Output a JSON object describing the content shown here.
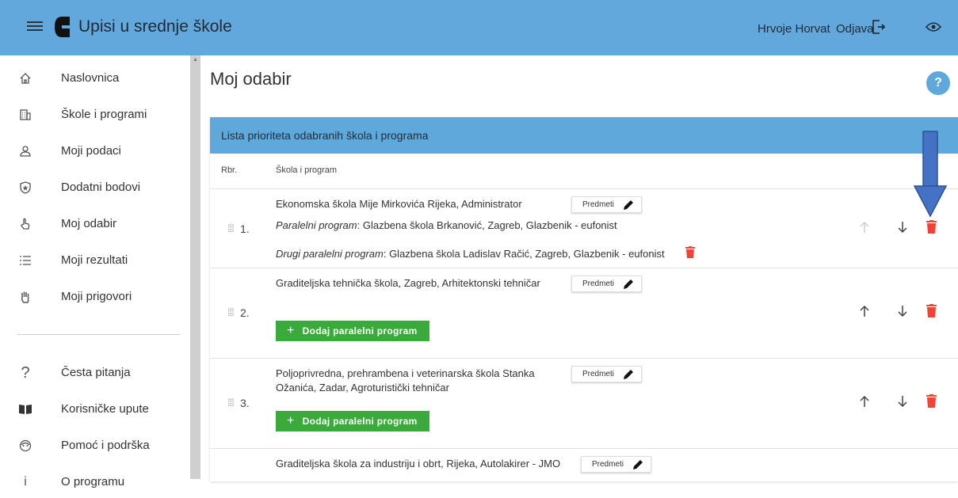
{
  "header": {
    "app_title": "Upisi u srednje škole",
    "user_name": "Hrvoje Horvat",
    "logout_label": "Odjava"
  },
  "sidebar": {
    "items": [
      {
        "label": "Naslovnica",
        "icon": "home-icon"
      },
      {
        "label": "Škole i programi",
        "icon": "building-icon"
      },
      {
        "label": "Moji podaci",
        "icon": "user-icon"
      },
      {
        "label": "Dodatni bodovi",
        "icon": "shield-star-icon"
      },
      {
        "label": "Moj odabir",
        "icon": "hand-pointer-icon"
      },
      {
        "label": "Moji rezultati",
        "icon": "list-icon"
      },
      {
        "label": "Moji prigovori",
        "icon": "raised-hand-icon"
      },
      {
        "label": "Česta pitanja",
        "icon": "question-icon"
      },
      {
        "label": "Korisničke upute",
        "icon": "book-icon"
      },
      {
        "label": "Pomoć i podrška",
        "icon": "support-icon"
      },
      {
        "label": "O programu",
        "icon": "info-icon"
      }
    ]
  },
  "main": {
    "page_title": "Moj odabir",
    "help_label": "?",
    "card_title": "Lista prioriteta odabranih škola i programa",
    "col_rbr": "Rbr.",
    "col_skola": "Škola i program",
    "predmeti_label": "Predmeti",
    "dodaj_label": "Dodaj paralelni program",
    "rows": [
      {
        "num": "1.",
        "school": "Ekonomska škola Mije Mirkovića Rijeka, Administrator",
        "parallel_prefix": "Paralelni program",
        "parallel": ": Glazbena škola Brkanović, Zagreb, Glazbenik - eufonist",
        "second_prefix": "Drugi paralelni program",
        "second": ": Glazbena škola Ladislav Račić, Zagreb, Glazbenik - eufonist"
      },
      {
        "num": "2.",
        "school": "Graditeljska tehnička škola, Zagreb, Arhitektonski tehničar"
      },
      {
        "num": "3.",
        "school": "Poljoprivredna, prehrambena i veterinarska škola Stanka Ožanića, Zadar, Agroturistički tehničar"
      },
      {
        "num": "4.",
        "school": "Graditeljska škola za industriju i obrt, Rijeka, Autolakirer - JMO"
      }
    ]
  },
  "colors": {
    "topbar": "#62a8dc",
    "card_header": "#5ea8dc",
    "trash": "#f44336",
    "add_button": "#3aaa3a",
    "annotation_arrow": "#4472c4"
  }
}
